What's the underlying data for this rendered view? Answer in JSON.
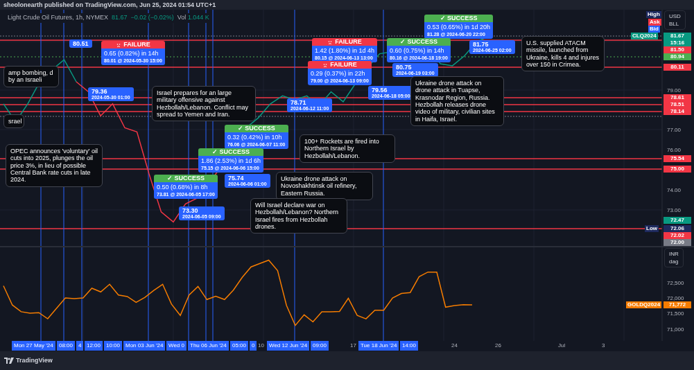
{
  "header": {
    "text": "sheolonearth published on TradingView.com, Jun 25, 2024 01:54 UTC+1"
  },
  "legend": {
    "symbol": "Light Crude Oil Futures, 1h, NYMEX",
    "price": "81.67",
    "change": "−0.02 (−0.02%)",
    "volume_label": "Vol",
    "volume": "1.044 K"
  },
  "price_scale": {
    "currency": [
      "USD",
      "BLL"
    ],
    "ticks": [
      "79.00",
      "77.00",
      "76.00",
      "74.00",
      "73.00"
    ],
    "tags": [
      {
        "text": "High",
        "color": "#1e2a5e"
      },
      {
        "text": "Ask",
        "color": "#f23645"
      },
      {
        "text": "Bid",
        "color": "#2962ff"
      },
      {
        "text": "CLQ2024",
        "color": "#089981"
      },
      {
        "text": "81.67",
        "color": "#089981"
      },
      {
        "text": "15:16",
        "color": "#089981"
      },
      {
        "text": "81.50",
        "color": "#f23645"
      },
      {
        "text": "80.94",
        "color": "#4caf50"
      },
      {
        "text": "80.11",
        "color": "#f23645"
      },
      {
        "text": "78.61",
        "color": "#f23645"
      },
      {
        "text": "78.51",
        "color": "#f23645"
      },
      {
        "text": "78.14",
        "color": "#f23645"
      },
      {
        "text": "75.54",
        "color": "#f23645"
      },
      {
        "text": "75.00",
        "color": "#f23645"
      },
      {
        "text": "72.47",
        "color": "#089981"
      },
      {
        "text": "Low",
        "color": "#1e2a5e"
      },
      {
        "text": "72.06",
        "color": "#1e2a5e"
      },
      {
        "text": "72.02",
        "color": "#f23645"
      },
      {
        "text": "72.00",
        "color": "#787b86"
      }
    ]
  },
  "callouts": [
    {
      "kind": "note",
      "text": "amp bombing, d by an Israeli"
    },
    {
      "kind": "pin",
      "price": "80.51"
    },
    {
      "kind": "failure",
      "status_label": "FAILURE",
      "result": "0.65 (0.82%) in 14h",
      "detail": "80.01 @ 2024-05-30  15:00"
    },
    {
      "kind": "pin",
      "price": "79.36",
      "date": "2024-05-30 01:00"
    },
    {
      "kind": "note",
      "text": "srael"
    },
    {
      "kind": "note",
      "text": "OPEC announces 'voluntary' oil cuts into 2025, plunges the oil price 3%, in lieu of possible Central Bank rate cuts in late 2024."
    },
    {
      "kind": "note",
      "text": "Israel prepares for an large military offensive against Hezbollah/Lebanon.  Conflict may spread to Yemen and Iran."
    },
    {
      "kind": "success",
      "status_label": "✓ SUCCESS",
      "result": "0.32 (0.42%) in 10h",
      "detail": "76.06 @ 2024-06-07  11:00"
    },
    {
      "kind": "success",
      "status_label": "✓ SUCCESS",
      "result": "1.86 (2.53%) in 1d 6h",
      "detail": "75.15 @ 2024-06-06  15:00"
    },
    {
      "kind": "success",
      "status_label": "✓ SUCCESS",
      "result": "0.50 (0.68%) in 8h",
      "detail": "73.81 @ 2024-06-05  17:00"
    },
    {
      "kind": "pin",
      "price": "75.74",
      "date": "2024-06-06 01:00"
    },
    {
      "kind": "pin",
      "price": "73.30",
      "date": "2024-06-05 09:00"
    },
    {
      "kind": "pin",
      "price": "78.71",
      "date": "2024-06-12 11:00"
    },
    {
      "kind": "note",
      "text": "100+ Rockets are fired into Northern Israel by Hezbollah/Lebanon."
    },
    {
      "kind": "note",
      "text": "Ukraine drone attack on Novoshakhtinsk oil refinery, Eastern Russia."
    },
    {
      "kind": "note",
      "text": "Will Israel declare war on Hezbollah/Lebanon?  Northern Israel fires from Hezbollah drones."
    },
    {
      "kind": "failure",
      "status_label": "FAILURE",
      "result": "1.42 (1.80%) in 1d 4h",
      "detail": "80.15 @ 2024-06-13  13:00"
    },
    {
      "kind": "failure",
      "status_label": "FAILURE",
      "result": "0.29 (0.37%) in 22h",
      "detail": "79.00 @ 2024-06-13  09:00"
    },
    {
      "kind": "pin",
      "price": "79.56",
      "date": "2024-06-18 05:00"
    },
    {
      "kind": "success",
      "status_label": "✓ SUCCESS",
      "result": "0.53 (0.65%) in 1d 20h",
      "detail": "81.28 @ 2024-06-20  22:00"
    },
    {
      "kind": "success",
      "status_label": "✓ SUCCESS",
      "result": "0.60 (0.75%) in 14h",
      "detail": "80.16 @ 2024-06-18  19:00"
    },
    {
      "kind": "pin",
      "price": "80.75",
      "date": "2024-06-19 03:00"
    },
    {
      "kind": "note",
      "text": "Ukraine drone attack on drone attack in Tuapse, Krasnodar Region, Russia. Hezbollah releases drone video of military, civilian sites in Haifa, Israel."
    },
    {
      "kind": "pin",
      "price": "81.75",
      "date": "2024-06-25 02:00"
    },
    {
      "kind": "note",
      "text": "U.S. supplied ATACM missile, launched from Ukraine, kills 4 and injures over 150 in Crimea."
    }
  ],
  "gold_scale": {
    "currency": [
      "INR",
      "dag"
    ],
    "ticks": [
      "72,500",
      "72,000",
      "71,500",
      "71,000"
    ],
    "tag": {
      "symbol": "GOLDQ2024",
      "price": "71,772"
    }
  },
  "time_axis": [
    {
      "text": "Mon 27 May '24",
      "highlighted": true
    },
    {
      "text": "08:00",
      "highlighted": true
    },
    {
      "text": "4",
      "highlighted": true
    },
    {
      "text": "12:00",
      "highlighted": true
    },
    {
      "text": "10:00",
      "highlighted": true
    },
    {
      "text": "Mon 03 Jun '24",
      "highlighted": true
    },
    {
      "text": "Wed 0",
      "highlighted": true
    },
    {
      "text": "Thu 06 Jun '24",
      "highlighted": true
    },
    {
      "text": "05:00",
      "highlighted": true
    },
    {
      "text": "0",
      "highlighted": true
    },
    {
      "text": "10",
      "highlighted": false
    },
    {
      "text": "Wed 12 Jun '24",
      "highlighted": true
    },
    {
      "text": "09:00",
      "highlighted": true
    },
    {
      "text": "17",
      "highlighted": false
    },
    {
      "text": "Tue 18 Jun '24",
      "highlighted": true
    },
    {
      "text": "14:00",
      "highlighted": true
    },
    {
      "text": "24",
      "highlighted": false
    },
    {
      "text": "26",
      "highlighted": false
    },
    {
      "text": "Jul",
      "highlighted": false
    },
    {
      "text": "3",
      "highlighted": false
    }
  ],
  "footer": {
    "brand": "TradingView"
  }
}
